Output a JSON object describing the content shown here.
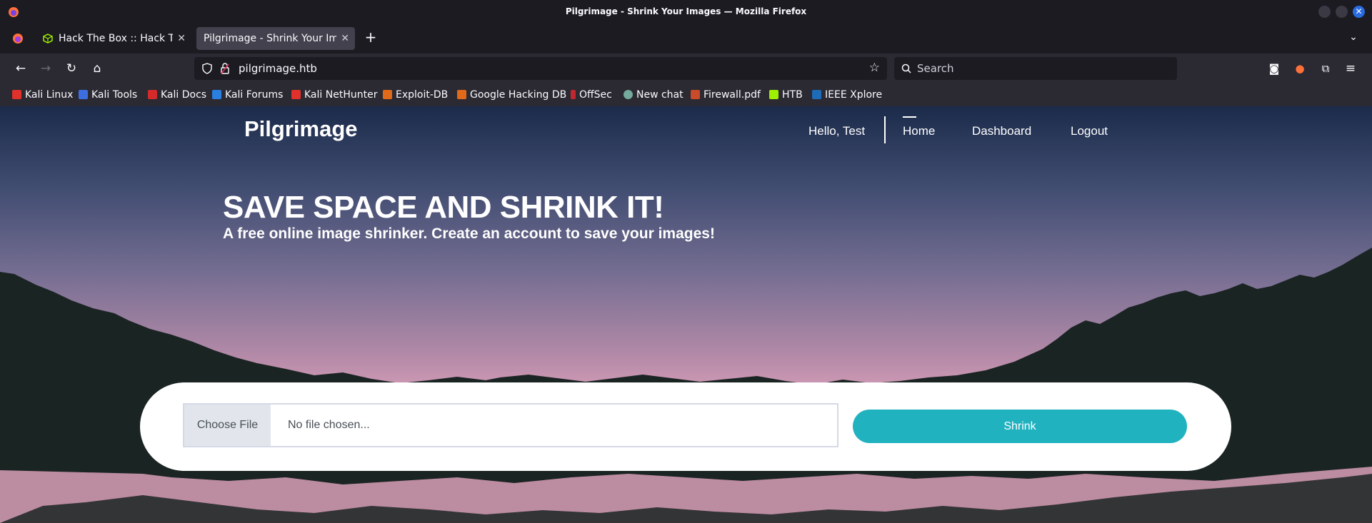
{
  "window": {
    "title": "Pilgrimage - Shrink Your Images — Mozilla Firefox"
  },
  "tabs": [
    {
      "label": "Hack The Box :: Hack The Box",
      "active": false,
      "favicon": "htb-cube-icon"
    },
    {
      "label": "Pilgrimage - Shrink Your Images",
      "active": true,
      "favicon": ""
    }
  ],
  "urlbar": {
    "url": "pilgrimage.htb"
  },
  "searchbar": {
    "placeholder": "Search"
  },
  "bookmarks": [
    {
      "label": "Kali Linux",
      "color": "#e0312b"
    },
    {
      "label": "Kali Tools",
      "color": "#3d6ee0"
    },
    {
      "label": "Kali Docs",
      "color": "#d42a2a"
    },
    {
      "label": "Kali Forums",
      "color": "#2a7fe0"
    },
    {
      "label": "Kali NetHunter",
      "color": "#e0312b"
    },
    {
      "label": "Exploit-DB",
      "color": "#e06a1a"
    },
    {
      "label": "Google Hacking DB",
      "color": "#e06a1a"
    },
    {
      "label": "OffSec",
      "color": "#c2262e"
    },
    {
      "label": "New chat",
      "color": "#74aa9c"
    },
    {
      "label": "Firewall.pdf",
      "color": "#c94b2a"
    },
    {
      "label": "HTB",
      "color": "#9fef00"
    },
    {
      "label": "IEEE Xplore",
      "color": "#1e6bb8"
    }
  ],
  "site": {
    "logo": "Pilgrimage",
    "nav": {
      "greeting": "Hello, Test",
      "home": "Home",
      "dashboard": "Dashboard",
      "logout": "Logout"
    },
    "hero": {
      "title": "SAVE SPACE AND SHRINK IT!",
      "subtitle": "A free online image shrinker. Create an account to save your images!"
    },
    "upload": {
      "choose_label": "Choose File",
      "file_placeholder": "No file chosen...",
      "shrink_label": "Shrink"
    }
  },
  "colors": {
    "accent": "#20b2bf",
    "mountain": "#1a2423"
  }
}
